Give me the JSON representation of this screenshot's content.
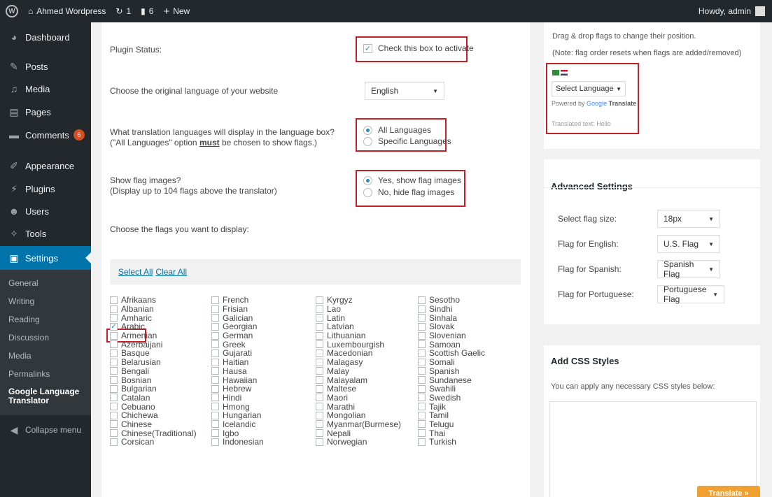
{
  "adminbar": {
    "site_name": "Ahmed Wordpress",
    "updates_count": "1",
    "comments_count": "6",
    "new_label": "New",
    "howdy": "Howdy, admin"
  },
  "sidebar": {
    "items": [
      {
        "label": "Dashboard",
        "icon": "dashboard-icon"
      },
      {
        "label": "Posts",
        "icon": "pin-icon"
      },
      {
        "label": "Media",
        "icon": "media-icon"
      },
      {
        "label": "Pages",
        "icon": "pages-icon"
      },
      {
        "label": "Comments",
        "icon": "comment-icon",
        "badge": "6"
      },
      {
        "label": "Appearance",
        "icon": "paintbrush-icon"
      },
      {
        "label": "Plugins",
        "icon": "plugin-icon"
      },
      {
        "label": "Users",
        "icon": "users-icon"
      },
      {
        "label": "Tools",
        "icon": "wrench-icon"
      },
      {
        "label": "Settings",
        "icon": "settings-icon"
      }
    ],
    "submenu": [
      "General",
      "Writing",
      "Reading",
      "Discussion",
      "Media",
      "Permalinks",
      "Google Language Translator"
    ],
    "collapse_label": "Collapse menu"
  },
  "main": {
    "plugin_status_label": "Plugin Status:",
    "activate_label": "Check this box to activate",
    "original_language_label": "Choose the original language of your website",
    "original_language_value": "English",
    "translation_langs_label_1": "What translation languages will display in the language box?",
    "translation_langs_label_2": "(\"All Languages\" option ",
    "translation_langs_must": "must",
    "translation_langs_label_3": " be chosen to show flags.)",
    "all_languages": "All Languages",
    "specific_languages": "Specific Languages",
    "show_flags_label_1": "Show flag images?",
    "show_flags_label_2": "(Display up to 104 flags above the translator)",
    "show_flags_yes": "Yes, show flag images",
    "show_flags_no": "No, hide flag images",
    "choose_flags_label": "Choose the flags you want to display:",
    "select_all": "Select All",
    "clear_all": "Clear All",
    "languages": [
      [
        "Afrikaans",
        "Albanian",
        "Amharic",
        "Arabic",
        "Armenian",
        "Azerbaijani",
        "Basque",
        "Belarusian",
        "Bengali",
        "Bosnian",
        "Bulgarian",
        "Catalan",
        "Cebuano",
        "Chichewa",
        "Chinese",
        "Chinese(Traditional)",
        "Corsican"
      ],
      [
        "French",
        "Frisian",
        "Galician",
        "Georgian",
        "German",
        "Greek",
        "Gujarati",
        "Haitian",
        "Hausa",
        "Hawaiian",
        "Hebrew",
        "Hindi",
        "Hmong",
        "Hungarian",
        "Icelandic",
        "Igbo",
        "Indonesian"
      ],
      [
        "Kyrgyz",
        "Lao",
        "Latin",
        "Latvian",
        "Lithuanian",
        "Luxembourgish",
        "Macedonian",
        "Malagasy",
        "Malay",
        "Malayalam",
        "Maltese",
        "Maori",
        "Marathi",
        "Mongolian",
        "Myanmar(Burmese)",
        "Nepali",
        "Norwegian"
      ],
      [
        "Sesotho",
        "Sindhi",
        "Sinhala",
        "Slovak",
        "Slovenian",
        "Samoan",
        "Scottish Gaelic",
        "Somali",
        "Spanish",
        "Sundanese",
        "Swahili",
        "Swedish",
        "Tajik",
        "Tamil",
        "Telugu",
        "Thai",
        "Turkish"
      ]
    ],
    "checked_language": "Arabic"
  },
  "preview": {
    "drag_text": "Drag & drop flags to change their position.",
    "note_text": "(Note: flag order resets when flags are added/removed)",
    "select_language": "Select Language",
    "powered_by": "Powered by",
    "google": "Google",
    "translate": "Translate",
    "translated_text": "Translated text:  Hello"
  },
  "advanced": {
    "title": "Advanced Settings",
    "rows": [
      {
        "label": "Select flag size:",
        "value": "18px"
      },
      {
        "label": "Flag for English:",
        "value": "U.S. Flag"
      },
      {
        "label": "Flag for Spanish:",
        "value": "Spanish Flag"
      },
      {
        "label": "Flag for Portuguese:",
        "value": "Portuguese Flag"
      }
    ]
  },
  "css_box": {
    "title": "Add CSS Styles",
    "hint": "You can apply any necessary CSS styles below:"
  },
  "translate_button": "Translate »"
}
